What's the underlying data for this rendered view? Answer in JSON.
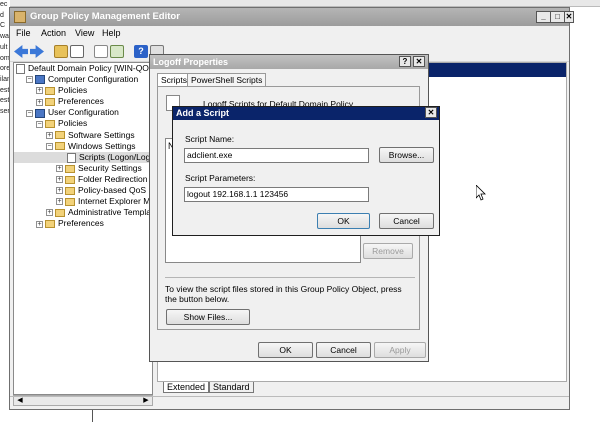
{
  "background_window": {
    "left_strip_text": [
      "ec",
      "d C",
      "wa",
      "ult",
      "om",
      "ore",
      "ilan",
      "est",
      "est",
      "ser"
    ]
  },
  "main_window": {
    "title": "Group Policy Management Editor",
    "buttons": {
      "minimize": "_",
      "maximize": "□",
      "close": "✕"
    },
    "menu": [
      "File",
      "Action",
      "View",
      "Help"
    ],
    "toolbar_icons": [
      "back-icon",
      "forward-icon",
      "up-folder-icon",
      "show-hide-tree-icon",
      "properties-icon",
      "export-icon",
      "help-icon",
      "mmc-icon"
    ],
    "tree": [
      {
        "label": "Default Domain Policy [WIN-QOCBI",
        "indent": 0,
        "expander": "",
        "icon": "policy"
      },
      {
        "label": "Computer Configuration",
        "indent": 1,
        "expander": "−",
        "icon": "computer"
      },
      {
        "label": "Policies",
        "indent": 2,
        "expander": "+",
        "icon": "folder"
      },
      {
        "label": "Preferences",
        "indent": 2,
        "expander": "+",
        "icon": "folder"
      },
      {
        "label": "User Configuration",
        "indent": 1,
        "expander": "−",
        "icon": "user"
      },
      {
        "label": "Policies",
        "indent": 2,
        "expander": "−",
        "icon": "folder"
      },
      {
        "label": "Software Settings",
        "indent": 3,
        "expander": "+",
        "icon": "folder"
      },
      {
        "label": "Windows Settings",
        "indent": 3,
        "expander": "−",
        "icon": "folder"
      },
      {
        "label": "Scripts (Logon/Log",
        "indent": 4,
        "expander": "",
        "icon": "script"
      },
      {
        "label": "Security Settings",
        "indent": 4,
        "expander": "+",
        "icon": "security"
      },
      {
        "label": "Folder Redirection",
        "indent": 4,
        "expander": "+",
        "icon": "folder"
      },
      {
        "label": "Policy-based QoS",
        "indent": 4,
        "expander": "+",
        "icon": "qos"
      },
      {
        "label": "Internet Explorer M",
        "indent": 4,
        "expander": "+",
        "icon": "ie"
      },
      {
        "label": "Administrative Templat",
        "indent": 3,
        "expander": "+",
        "icon": "folder"
      },
      {
        "label": "Preferences",
        "indent": 2,
        "expander": "+",
        "icon": "folder"
      }
    ],
    "bottom_tabs": [
      "Extended",
      "Standard"
    ]
  },
  "logoff_dialog": {
    "title": "Logoff Properties",
    "help_button": "?",
    "close_button": "✕",
    "tabs": [
      "Scripts",
      "PowerShell Scripts"
    ],
    "header_text": "Logoff Scripts for Default Domain Policy",
    "list_header_fragment": "N",
    "remove_button": "Remove",
    "info_text": "To view the script files stored in this Group Policy Object, press the button below.",
    "show_files_button": "Show Files...",
    "ok": "OK",
    "cancel": "Cancel",
    "apply": "Apply"
  },
  "add_script_dialog": {
    "title": "Add a Script",
    "close_button": "✕",
    "script_name_label": "Script Name:",
    "script_name_value": "adclient.exe",
    "browse_button": "Browse...",
    "script_params_label": "Script Parameters:",
    "script_params_value": "logout 192.168.1.1 123456",
    "ok": "OK",
    "cancel": "Cancel"
  },
  "colors": {
    "accent": "#0a246a",
    "inactive_title": "#a8a8a8"
  }
}
